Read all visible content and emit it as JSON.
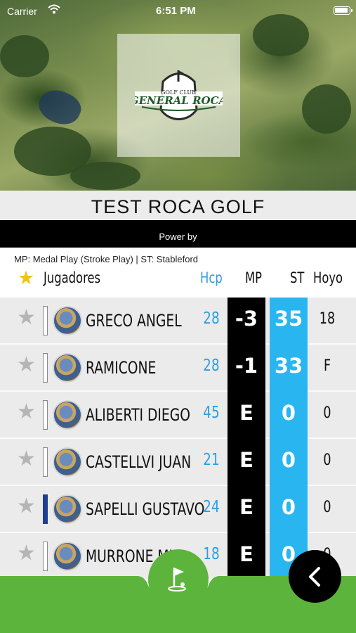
{
  "status_bar": {
    "carrier": "Carrier",
    "time": "6:51 PM"
  },
  "header": {
    "title": "TEST ROCA GOLF",
    "powered_by": "Power by"
  },
  "logo": {
    "line1": "GOLF CLUB",
    "line2": "GENERAL ROCA"
  },
  "legend_text": "MP: Medal Play (Stroke Play) | ST: Stableford",
  "table": {
    "columns": {
      "players": "Jugadores",
      "hcp": "Hcp",
      "mp": "MP",
      "st": "ST",
      "hoyo": "Hoyo"
    },
    "rows": [
      {
        "name": "GRECO ANGEL",
        "hcp": "28",
        "mp": "-3",
        "st": "35",
        "hoyo": "18",
        "bar_color": "#ffffff"
      },
      {
        "name": "RAMICONE",
        "hcp": "28",
        "mp": "-1",
        "st": "33",
        "hoyo": "F",
        "bar_color": "#ffffff"
      },
      {
        "name": "ALIBERTI DIEGO",
        "hcp": "45",
        "mp": "E",
        "st": "0",
        "hoyo": "0",
        "bar_color": "#ffffff"
      },
      {
        "name": "CASTELLVI JUAN",
        "hcp": "21",
        "mp": "E",
        "st": "0",
        "hoyo": "0",
        "bar_color": "#ffffff"
      },
      {
        "name": "SAPELLI GUSTAVO",
        "hcp": "24",
        "mp": "E",
        "st": "0",
        "hoyo": "0",
        "bar_color": "#1e3f8f"
      },
      {
        "name": "MURRONE MI",
        "hcp": "18",
        "mp": "E",
        "st": "0",
        "hoyo": "0",
        "bar_color": "#ffffff"
      }
    ]
  },
  "colors": {
    "accent_blue": "#29b6f0",
    "hcp_blue": "#2a9fe0",
    "green": "#5cb43c",
    "star_yellow": "#f1c40f"
  },
  "icons": {
    "favorite": "star-icon",
    "bottom_center": "golf-flag-icon",
    "back": "chevron-left-icon"
  }
}
